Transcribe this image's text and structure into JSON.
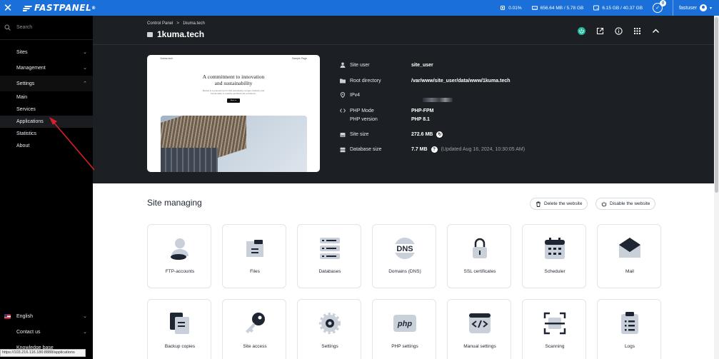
{
  "topbar": {
    "brand": "FASTPANEL",
    "brand_mark": "®",
    "cpu": "0.01%",
    "ram": "656.64 MB / 5.78 GB",
    "disk": "6.15 GB / 40.37 GB",
    "notifications": "0",
    "username": "fastuser"
  },
  "sidebar": {
    "search_placeholder": "Search",
    "items": [
      {
        "label": "Sites"
      },
      {
        "label": "Management"
      },
      {
        "label": "Settings"
      }
    ],
    "sub_items": [
      {
        "label": "Main"
      },
      {
        "label": "Services"
      },
      {
        "label": "Applications"
      },
      {
        "label": "Statistics"
      },
      {
        "label": "About"
      }
    ],
    "bottom": [
      {
        "label": "English"
      },
      {
        "label": "Contact us"
      },
      {
        "label": "Knowledge base"
      }
    ],
    "status_url": "https://103.216.116.186:8888/applications"
  },
  "header": {
    "breadcrumb_root": "Control Panel",
    "breadcrumb_sep": ">",
    "breadcrumb_current": "1kuma.tech",
    "title": "1kuma.tech"
  },
  "preview": {
    "nav_left": "1kuma.tech",
    "nav_right": "Sample Page",
    "heading_line1": "A commitment to innovation",
    "heading_line2": "and sustainability",
    "para_line1": "Études is a pioneering firm that seamlessly merges creativity and",
    "para_line2": "functionality to redefine architectural excellence.",
    "button": "About us"
  },
  "info": {
    "site_user_label": "Site user",
    "site_user": "site_user",
    "root_label": "Root directory",
    "root": "/var/www/site_user/data/www/1kuma.tech",
    "ipv4_label": "IPv4",
    "php_mode_label": "PHP Mode",
    "php_mode": "PHP-FPM",
    "php_version_label": "PHP version",
    "php_version": "PHP 8.1",
    "site_size_label": "Site size",
    "site_size": "272.6 MB",
    "db_size_label": "Database size",
    "db_size": "7.7 MB",
    "db_updated": "(Updated Aug 16, 2024, 10:30:05 AM)"
  },
  "manage": {
    "title": "Site managing",
    "delete_btn": "Delete the website",
    "disable_btn": "Disable the website",
    "cards": [
      {
        "label": "FTP-accounts",
        "icon": "users-icon"
      },
      {
        "label": "Files",
        "icon": "folder-icon"
      },
      {
        "label": "Databases",
        "icon": "database-icon"
      },
      {
        "label": "Domains (DNS)",
        "icon": "dns-icon",
        "icon_text": "DNS"
      },
      {
        "label": "SSL certificates",
        "icon": "lock-icon"
      },
      {
        "label": "Scheduler",
        "icon": "calendar-icon"
      },
      {
        "label": "Mail",
        "icon": "mail-icon"
      },
      {
        "label": "Backup copies",
        "icon": "backup-icon"
      },
      {
        "label": "Site access",
        "icon": "key-icon"
      },
      {
        "label": "Settings",
        "icon": "gear-icon"
      },
      {
        "label": "PHP settings",
        "icon": "php-icon",
        "icon_text": "php"
      },
      {
        "label": "Manual settings",
        "icon": "code-icon"
      },
      {
        "label": "Scanning",
        "icon": "scan-icon"
      },
      {
        "label": "Logs",
        "icon": "logs-icon"
      }
    ]
  },
  "colors": {
    "topbar": "#1a6fd8",
    "sidebar": "#000000",
    "hero": "#1c1f24",
    "icon_fill": "#c9d0da",
    "icon_dark": "#1f2633",
    "annotation_arrow": "#d6202a",
    "status_ok": "#1fb89a"
  }
}
